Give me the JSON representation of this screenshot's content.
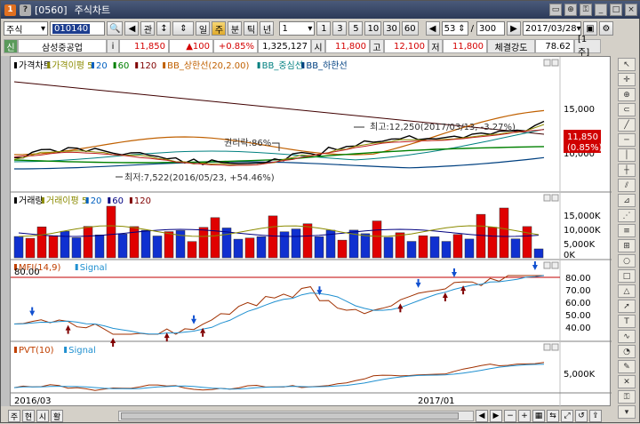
{
  "window": {
    "number_tag": "[0560]",
    "title": "주식차트",
    "logo_letter": "1"
  },
  "toolbar": {
    "market": "주식",
    "code": "010140",
    "btn_gwan": "관",
    "period_buttons": [
      "일",
      "주",
      "분",
      "틱",
      "년"
    ],
    "period_active": "주",
    "interval_value": "1",
    "interval_buttons": [
      "1",
      "3",
      "5",
      "10",
      "30",
      "60"
    ],
    "count_a": "53",
    "count_b": "300",
    "date": "2017/03/28"
  },
  "quote": {
    "info_icon": "신",
    "name": "삼성중공업",
    "info_mark": "i",
    "price": "11,850",
    "change": "▲100",
    "change_pct": "+0.85%",
    "volume": "1,325,127",
    "open_label": "시",
    "open": "11,800",
    "high_label": "고",
    "high": "12,100",
    "low_label": "저",
    "low": "11,800",
    "strength_label": "체결강도",
    "strength": "78.62",
    "unit_btn": "[1주]"
  },
  "panes": {
    "price": {
      "legend": [
        {
          "label": "가격차트",
          "color": "#000000"
        },
        {
          "label": "가격이평 5",
          "color": "#8b8b00"
        },
        {
          "label": "20",
          "color": "#0060c0"
        },
        {
          "label": "60",
          "color": "#008000"
        },
        {
          "label": "120",
          "color": "#800000"
        },
        {
          "label": "BB_상한선(20,2.00)",
          "color": "#c06000"
        },
        {
          "label": "BB_중심선",
          "color": "#008080"
        },
        {
          "label": "BB_하한선",
          "color": "#004080"
        }
      ],
      "y_tick_15000": "15,000",
      "y_tick_10000": "10,000",
      "price_box_value": "11,850",
      "price_box_pct": "(0.85%)",
      "ann_high": "최고:12,250(2017/03/13, -3.27%)",
      "ann_low": "최저:7,522(2016/05/23, +54.46%)",
      "ann_rights": "권리락:86%"
    },
    "volume": {
      "legend": [
        {
          "label": "거래량",
          "color": "#000000"
        },
        {
          "label": "거래이평 5",
          "color": "#8b8b00"
        },
        {
          "label": "20",
          "color": "#0060c0"
        },
        {
          "label": "60",
          "color": "#000080"
        },
        {
          "label": "120",
          "color": "#800000"
        }
      ],
      "ticks": [
        "15,000K",
        "10,000K",
        "5,000K",
        "0K"
      ]
    },
    "mfi": {
      "legend": [
        {
          "label": "MFI(14,9)",
          "color": "#c04000"
        },
        {
          "label": "Signal",
          "color": "#2090d0"
        }
      ],
      "level_label": "80.00",
      "ticks": [
        "80.00",
        "70.00",
        "60.00",
        "50.00",
        "40.00"
      ]
    },
    "pvt": {
      "legend": [
        {
          "label": "PVT(10)",
          "color": "#c04000"
        },
        {
          "label": "Signal",
          "color": "#2090d0"
        }
      ],
      "ticks": [
        "5,000K"
      ]
    },
    "x_axis": [
      "2016/03",
      "2017/01"
    ]
  },
  "bottom": {
    "buttons": [
      "주",
      "현",
      "시",
      "활"
    ]
  },
  "colors": {
    "up": "#e00000",
    "down": "#1030d0",
    "accent": "#1c3d8f"
  }
}
